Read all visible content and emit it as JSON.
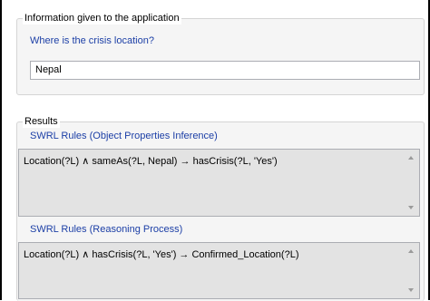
{
  "info_group": {
    "legend": "Information given to the application",
    "question": "Where is the crisis location?",
    "answer_value": "Nepal"
  },
  "results_group": {
    "legend": "Results",
    "object_properties": {
      "label": "SWRL Rules (Object Properties Inference)",
      "content": "Location(?L) ∧ sameAs(?L, Nepal) → hasCrisis(?L, 'Yes')"
    },
    "reasoning": {
      "label": "SWRL Rules (Reasoning Process)",
      "content": "Location(?L) ∧ hasCrisis(?L, 'Yes') → Confirmed_Location(?L)"
    }
  }
}
